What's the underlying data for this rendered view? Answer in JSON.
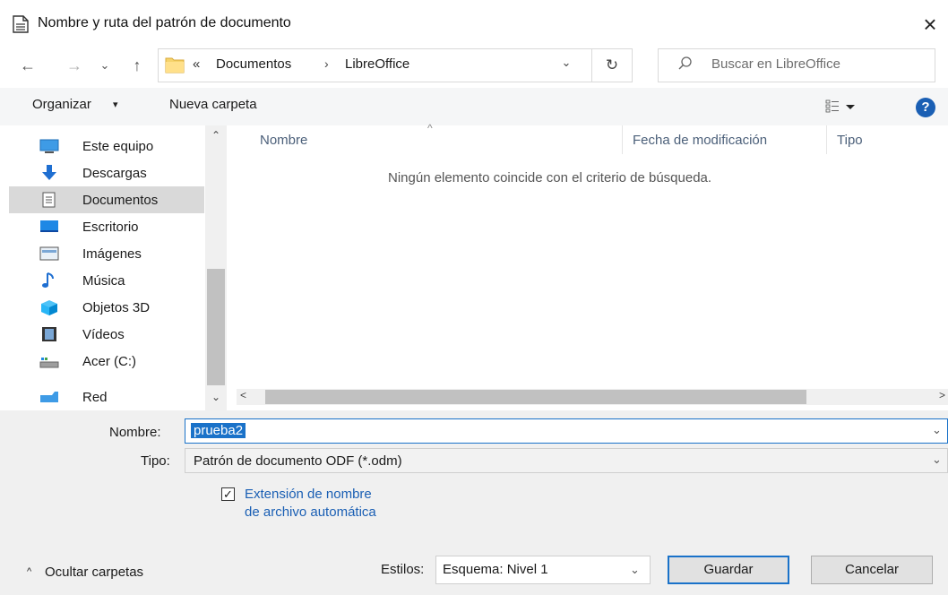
{
  "window": {
    "title": "Nombre y ruta del patrón de documento",
    "close_glyph": "×"
  },
  "nav": {
    "back": "←",
    "forward": "→",
    "recent": "⌄",
    "up": "↑",
    "refresh": "↻",
    "breadcrumb_chevron": "«",
    "breadcrumb": [
      "Documentos",
      "LibreOffice"
    ],
    "breadcrumb_separator": "›",
    "address_dropdown": "⌄",
    "search_placeholder": "Buscar en LibreOffice"
  },
  "toolbar": {
    "organize_label": "Organizar",
    "organize_caret": "▾",
    "new_folder_label": "Nueva carpeta",
    "help_label": "?"
  },
  "sidebar": {
    "items": [
      {
        "label": "Este equipo",
        "icon": "pc-icon"
      },
      {
        "label": "Descargas",
        "icon": "downloads-icon"
      },
      {
        "label": "Documentos",
        "icon": "documents-icon",
        "selected": true
      },
      {
        "label": "Escritorio",
        "icon": "desktop-icon"
      },
      {
        "label": "Imágenes",
        "icon": "pictures-icon"
      },
      {
        "label": "Música",
        "icon": "music-icon"
      },
      {
        "label": "Objetos 3D",
        "icon": "3d-objects-icon"
      },
      {
        "label": "Vídeos",
        "icon": "videos-icon"
      },
      {
        "label": "Acer (C:)",
        "icon": "drive-icon"
      },
      {
        "label": "Red",
        "icon": "network-icon"
      }
    ],
    "scroll_up": "⌃",
    "scroll_down": "⌄"
  },
  "file_list": {
    "columns": [
      "Nombre",
      "Fecha de modificación",
      "Tipo"
    ],
    "sort_indicator": "^",
    "empty_message": "Ningún elemento coincide con el criterio de búsqueda.",
    "scroll_left": "<",
    "scroll_right": ">"
  },
  "form": {
    "name_label": "Nombre:",
    "name_value": "prueba2",
    "type_label": "Tipo:",
    "type_value": "Patrón de documento ODF (*.odm)",
    "dropdown_glyph": "⌄",
    "auto_extension_label_line1": "Extensión de nombre",
    "auto_extension_label_line2": "de archivo automática",
    "auto_extension_checked": true,
    "auto_extension_check_glyph": "✓",
    "styles_label": "Estilos:",
    "styles_value": "Esquema: Nivel 1"
  },
  "footer": {
    "toggle_caret": "^",
    "toggle_folders_label": "Ocultar carpetas",
    "save_label": "Guardar",
    "cancel_label": "Cancelar"
  },
  "colors": {
    "accent": "#1a72c9",
    "help": "#1a5fb4",
    "selected": "#d9d9d9",
    "panel": "#f0f0f0"
  }
}
